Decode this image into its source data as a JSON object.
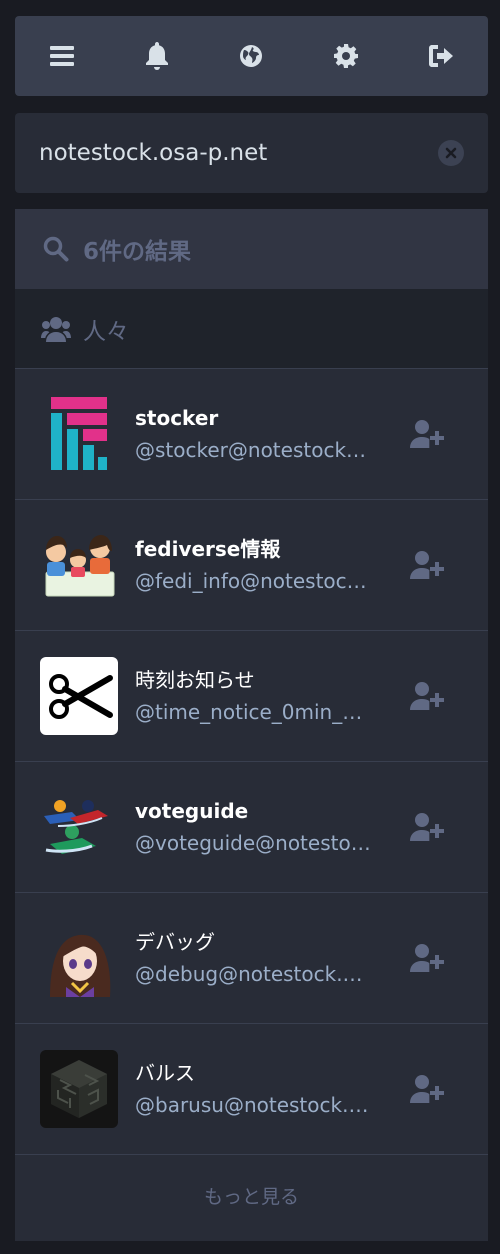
{
  "topbar": {
    "icons": [
      "menu-icon",
      "bell-icon",
      "globe-icon",
      "gear-icon",
      "sign-out-icon"
    ]
  },
  "search": {
    "value": "notestock.osa-p.net"
  },
  "results": {
    "count_label": "6件の結果",
    "section_label": "人々",
    "accounts": [
      {
        "display_name": "stocker",
        "acct": "@stocker@notestock…"
      },
      {
        "display_name": "fediverse情報",
        "acct": "@fedi_info@notestoc…"
      },
      {
        "display_name": "時刻お知らせ",
        "acct": "@time_notice_0min_…"
      },
      {
        "display_name": "voteguide",
        "acct": "@voteguide@notesto…"
      },
      {
        "display_name": "デバッグ",
        "acct": "@debug@notestock.…"
      },
      {
        "display_name": "バルス",
        "acct": "@barusu@notestock.…"
      }
    ],
    "more_label": "もっと見る"
  },
  "colors": {
    "background": "#191b22",
    "panel": "#282c37",
    "topbar": "#393f4f",
    "muted": "#606984",
    "acct": "#9baec8"
  }
}
